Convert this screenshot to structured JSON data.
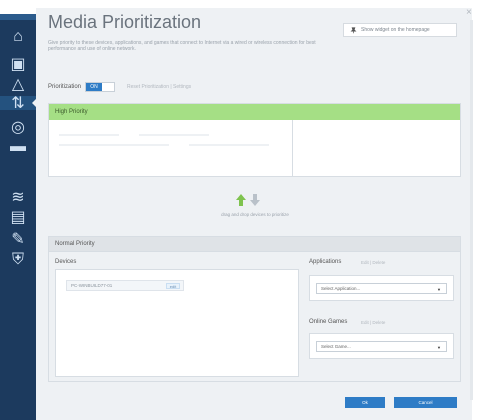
{
  "page": {
    "title": "Media Prioritization",
    "description": "Give priority to these devices, applications, and games that connect to Internet via a wired or wireless connection for best performance and use of online network."
  },
  "top_button": {
    "label": "Show widget on the homepage",
    "icon": "pin-icon"
  },
  "close": {
    "glyph": "×"
  },
  "sidebar": {
    "icons": [
      {
        "name": "home-icon",
        "glyph": "⌂"
      },
      {
        "name": "devices-icon",
        "glyph": "▣"
      },
      {
        "name": "alert-icon",
        "glyph": "△"
      },
      {
        "name": "prioritization-icon",
        "glyph": "⇅"
      },
      {
        "name": "globe-icon",
        "glyph": "◎"
      },
      {
        "name": "speed-icon",
        "glyph": "▬"
      },
      {
        "name": "wifi-icon",
        "glyph": "≋"
      },
      {
        "name": "storage-icon",
        "glyph": "▤"
      },
      {
        "name": "tools-icon",
        "glyph": "✎"
      },
      {
        "name": "security-icon",
        "glyph": "⛨"
      }
    ]
  },
  "prioritization": {
    "label": "Prioritization",
    "toggle_on_label": "ON",
    "links": "Reset Prioritization  |  Settings"
  },
  "high_priority": {
    "header": "High Priority",
    "hint": "drag and drop devices to prioritize"
  },
  "normal_priority": {
    "header": "Normal Priority",
    "devices_label": "Devices",
    "device_chip": "PC-WINBUILD77-01",
    "device_tag": "edit",
    "applications_label": "Applications",
    "applications_links": "Edit  |  Delete",
    "applications_select": "Select Application...",
    "games_label": "Online Games",
    "games_links": "Edit  |  Delete",
    "games_select": "Select Game..."
  },
  "footer": {
    "ok_label": "Ok",
    "cancel_label": "Cancel"
  },
  "colors": {
    "sidebar": "#1c3a5e",
    "accent_blue": "#2e7cc6",
    "high_priority_green": "#a5df85",
    "arrow_green": "#7fc34f",
    "panel_bg": "#eef1f4"
  }
}
